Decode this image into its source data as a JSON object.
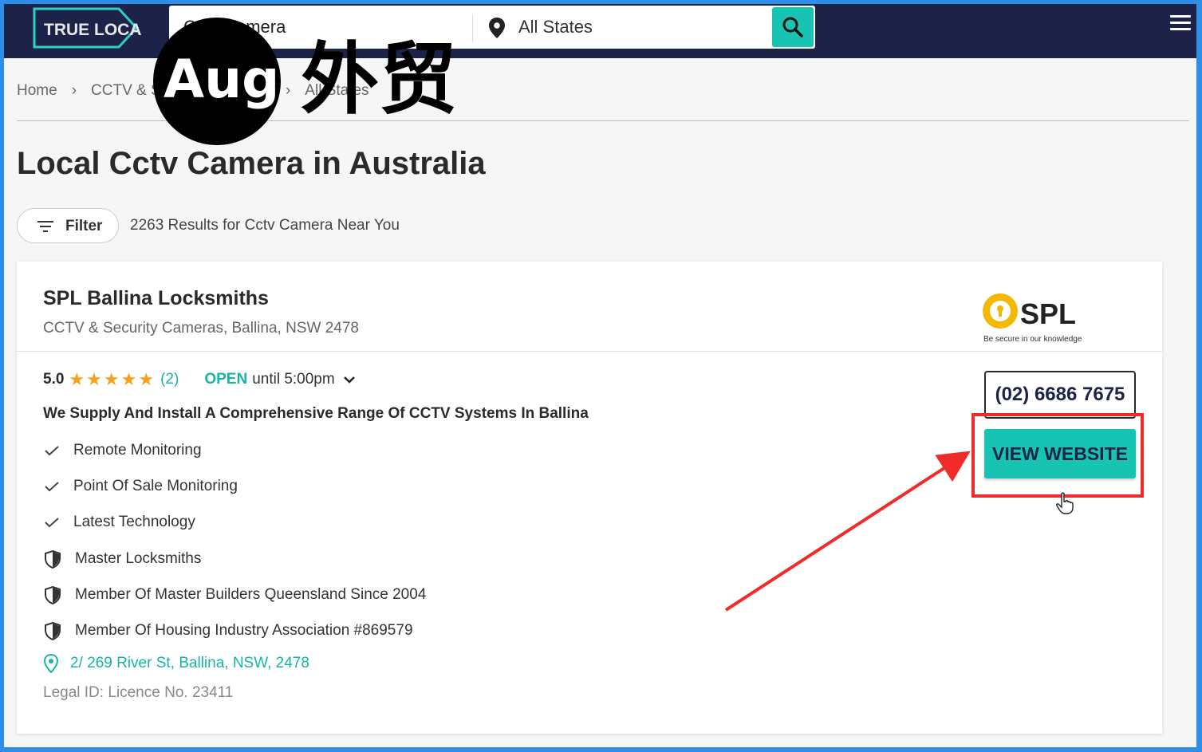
{
  "header": {
    "logo_text": "TRUE LOCAL",
    "search_value": "Cctv Camera",
    "location_value": "All States"
  },
  "breadcrumb": {
    "items": [
      "Home",
      "CCTV & Security Cameras",
      "All States"
    ]
  },
  "page": {
    "title": "Local Cctv Camera in Australia",
    "filter_label": "Filter",
    "results_text": "2263 Results for Cctv Camera Near You"
  },
  "listing": {
    "name": "SPL Ballina Locksmiths",
    "subtitle": "CCTV & Security Cameras, Ballina, NSW 2478",
    "logo_text": "SPL",
    "logo_tagline": "Be secure in our knowledge",
    "rating": "5.0",
    "stars": 5,
    "review_count": "(2)",
    "open_label": "OPEN",
    "open_until": "until 5:00pm",
    "tagline": "We Supply And Install A Comprehensive Range Of CCTV Systems In Ballina",
    "features": [
      {
        "icon": "check-icon",
        "text": "Remote Monitoring"
      },
      {
        "icon": "check-icon",
        "text": "Point Of Sale Monitoring"
      },
      {
        "icon": "check-icon",
        "text": "Latest Technology"
      },
      {
        "icon": "shield-icon",
        "text": "Master Locksmiths"
      },
      {
        "icon": "shield-icon",
        "text": "Member Of Master Builders Queensland Since 2004"
      },
      {
        "icon": "shield-icon",
        "text": "Member Of Housing Industry Association #869579"
      }
    ],
    "address": "2/ 269 River St, Ballina, NSW, 2478",
    "legal": "Legal ID: Licence No. 23411",
    "phone": "(02) 6686 7675",
    "website_label": "VIEW WEBSITE"
  },
  "watermark": {
    "circle_text": "Aug",
    "chinese_text": "外贸"
  },
  "colors": {
    "header_bg": "#1d2248",
    "accent": "#17c3b2",
    "annotation_red": "#f12a2a",
    "star": "#f5a11c",
    "frame": "#2f8fe8"
  }
}
